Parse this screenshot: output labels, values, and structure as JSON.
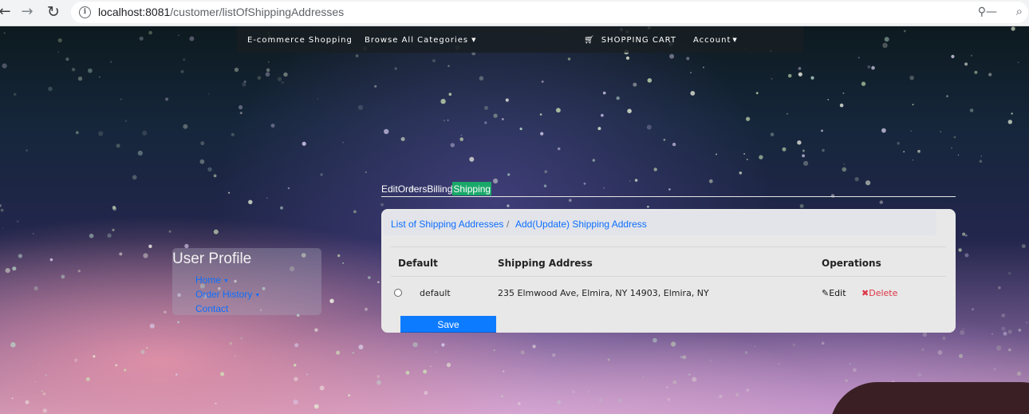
{
  "browser": {
    "url_host": "localhost:8081",
    "url_path": "/customer/listOfShippingAddresses"
  },
  "nav": {
    "brand": "E-commerce Shopping",
    "browse": "Browse All Categories",
    "cart": "SHOPPING CART",
    "account": "Account"
  },
  "profile": {
    "title": "User Profile",
    "links": [
      "Home",
      "Order History",
      "Contact"
    ]
  },
  "tabs": [
    {
      "label": "Edit",
      "active": false
    },
    {
      "label": "Orders",
      "active": false
    },
    {
      "label": "Billing",
      "active": false
    },
    {
      "label": "Shipping",
      "active": true
    }
  ],
  "breadcrumb": {
    "list": "List of Shipping Addresses",
    "separator": "/",
    "add": "Add(Update) Shipping Address"
  },
  "table": {
    "headers": [
      "Default",
      "Shipping Address",
      "Operations"
    ],
    "rows": [
      {
        "default_label": "default",
        "address": "235 Elmwood Ave, Elmira, NY 14903, Elmira, NY",
        "edit": "Edit",
        "delete": "Delete"
      }
    ]
  },
  "save_label": "Save",
  "colors": {
    "link": "#0d6efd",
    "active_tab": "#1aa86a",
    "save_button": "#0d7bff",
    "delete": "#dc3545"
  },
  "icons": [
    "back-arrow-icon",
    "forward-arrow-icon",
    "reload-icon",
    "info-icon",
    "key-icon",
    "zoom-icon",
    "cart-icon",
    "pencil-icon",
    "x-icon"
  ]
}
